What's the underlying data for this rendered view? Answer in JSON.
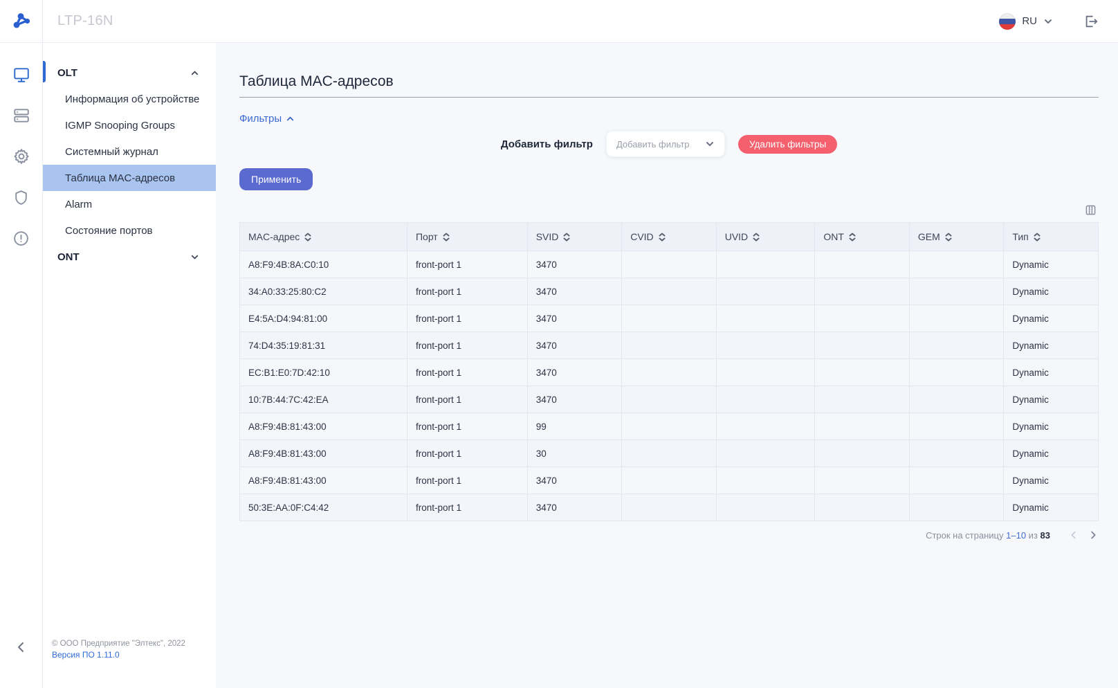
{
  "topbar": {
    "device_title": "LTP-16N",
    "language": "RU"
  },
  "sidebar": {
    "groups": [
      {
        "label": "OLT",
        "expanded": true,
        "items": [
          {
            "label": "Информация об устройстве",
            "active": false
          },
          {
            "label": "IGMP Snooping Groups",
            "active": false
          },
          {
            "label": "Системный журнал",
            "active": false
          },
          {
            "label": "Таблица MAC-адресов",
            "active": true
          },
          {
            "label": "Alarm",
            "active": false
          },
          {
            "label": "Состояние портов",
            "active": false
          }
        ]
      },
      {
        "label": "ONT",
        "expanded": false,
        "items": []
      }
    ],
    "footer": {
      "copyright": "© ООО Предприятие \"Элтекс\", 2022",
      "version_link": "Версия ПО 1.11.0"
    }
  },
  "main": {
    "title": "Таблица MAC-адресов",
    "filters": {
      "toggle_label": "Фильтры",
      "add_filter_label": "Добавить фильтр",
      "select_placeholder": "Добавить фильтр",
      "clear_button": "Удалить фильтры",
      "apply_button": "Применить"
    },
    "table": {
      "columns": [
        "MAC-адрес",
        "Порт",
        "SVID",
        "CVID",
        "UVID",
        "ONT",
        "GEM",
        "Тип"
      ],
      "column_widths_pct": [
        19.5,
        14,
        11,
        11,
        11.5,
        11,
        11,
        11
      ],
      "rows": [
        [
          "A8:F9:4B:8A:C0:10",
          "front-port 1",
          "3470",
          "",
          "",
          "",
          "",
          "Dynamic"
        ],
        [
          "34:A0:33:25:80:C2",
          "front-port 1",
          "3470",
          "",
          "",
          "",
          "",
          "Dynamic"
        ],
        [
          "E4:5A:D4:94:81:00",
          "front-port 1",
          "3470",
          "",
          "",
          "",
          "",
          "Dynamic"
        ],
        [
          "74:D4:35:19:81:31",
          "front-port 1",
          "3470",
          "",
          "",
          "",
          "",
          "Dynamic"
        ],
        [
          "EC:B1:E0:7D:42:10",
          "front-port 1",
          "3470",
          "",
          "",
          "",
          "",
          "Dynamic"
        ],
        [
          "10:7B:44:7C:42:EA",
          "front-port 1",
          "3470",
          "",
          "",
          "",
          "",
          "Dynamic"
        ],
        [
          "A8:F9:4B:81:43:00",
          "front-port 1",
          "99",
          "",
          "",
          "",
          "",
          "Dynamic"
        ],
        [
          "A8:F9:4B:81:43:00",
          "front-port 1",
          "30",
          "",
          "",
          "",
          "",
          "Dynamic"
        ],
        [
          "A8:F9:4B:81:43:00",
          "front-port 1",
          "3470",
          "",
          "",
          "",
          "",
          "Dynamic"
        ],
        [
          "50:3E:AA:0F:C4:42",
          "front-port 1",
          "3470",
          "",
          "",
          "",
          "",
          "Dynamic"
        ]
      ]
    },
    "pagination": {
      "rows_per_page_label": "Строк на страницу",
      "range": "1–10",
      "of_label": "из",
      "total": "83"
    }
  },
  "icons": {
    "rail": [
      "monitor-icon",
      "server-icon",
      "gear-icon",
      "shield-icon",
      "alert-circle-icon"
    ],
    "topbar": [
      "flag-ru-icon",
      "chevron-down-icon",
      "logout-icon"
    ],
    "other": [
      "columns-icon",
      "sort-icon",
      "chevron-up-icon",
      "chevron-left-icon",
      "chevron-right-icon"
    ]
  },
  "colors": {
    "accent_blue": "#2e6ad1",
    "primary_button": "#5a6ace",
    "danger_button": "#f4606d",
    "active_item_highlight": "#a9c4ef",
    "content_background": "#f6f8fc",
    "table_header_background": "#eef1f7",
    "link_blue": "#3b6ad1"
  }
}
